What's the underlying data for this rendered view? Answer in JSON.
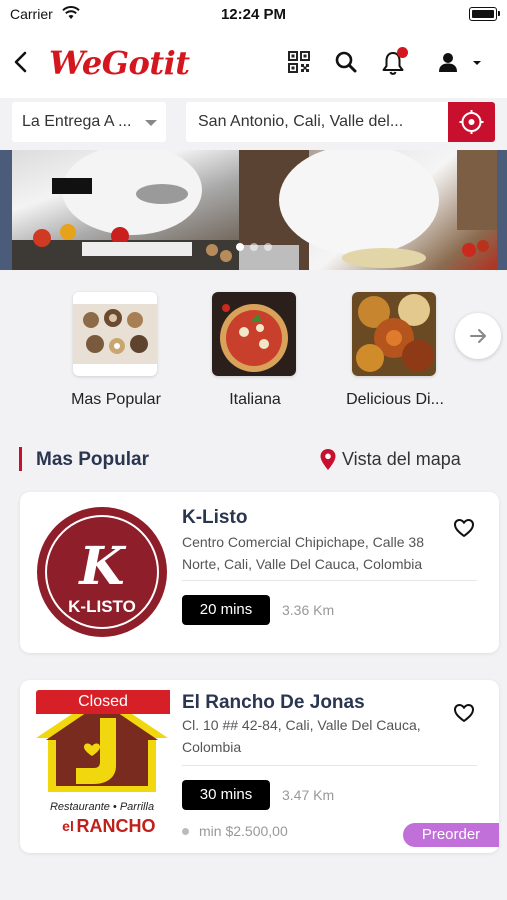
{
  "status_bar": {
    "carrier": "Carrier",
    "time": "12:24 PM"
  },
  "header": {
    "logo_text": "WeGotit",
    "brand_color": "#d4161e",
    "notification_badge": true
  },
  "location_bar": {
    "delivery_mode": "La Entrega A ...",
    "address": "San Antonio, Cali, Valle del...",
    "accent_color": "#c8102e"
  },
  "banner": {
    "slide_count": 3,
    "active_slide": 1
  },
  "categories": [
    {
      "label": "Mas Popular",
      "icon": "food-platter-image"
    },
    {
      "label": "Italiana",
      "icon": "pizza-image"
    },
    {
      "label": "Delicious Di...",
      "icon": "curry-dishes-image"
    }
  ],
  "section": {
    "title": "Mas Popular",
    "map_link": "Vista del mapa"
  },
  "restaurants": [
    {
      "name": "K-Listo",
      "address": "Centro Comercial Chipichape, Calle 38 Norte, Cali, Valle Del Cauca, Colombia",
      "time": "20 mins",
      "distance": "3.36 Km",
      "logo_text": "K-LISTO",
      "logo_letter": "K",
      "closed": false
    },
    {
      "name": "El Rancho De Jonas",
      "address": "Cl. 10 ## 42-84, Cali, Valle Del Cauca, Colombia",
      "time": "30 mins",
      "distance": "3.47 Km",
      "status_tag": "Closed",
      "min_order": "min $2.500,00",
      "preorder_label": "Preorder",
      "logo_line1": "Restaurante • Parrilla",
      "logo_line2_a": "el",
      "logo_line2_b": "RANCHO",
      "closed": true
    }
  ]
}
